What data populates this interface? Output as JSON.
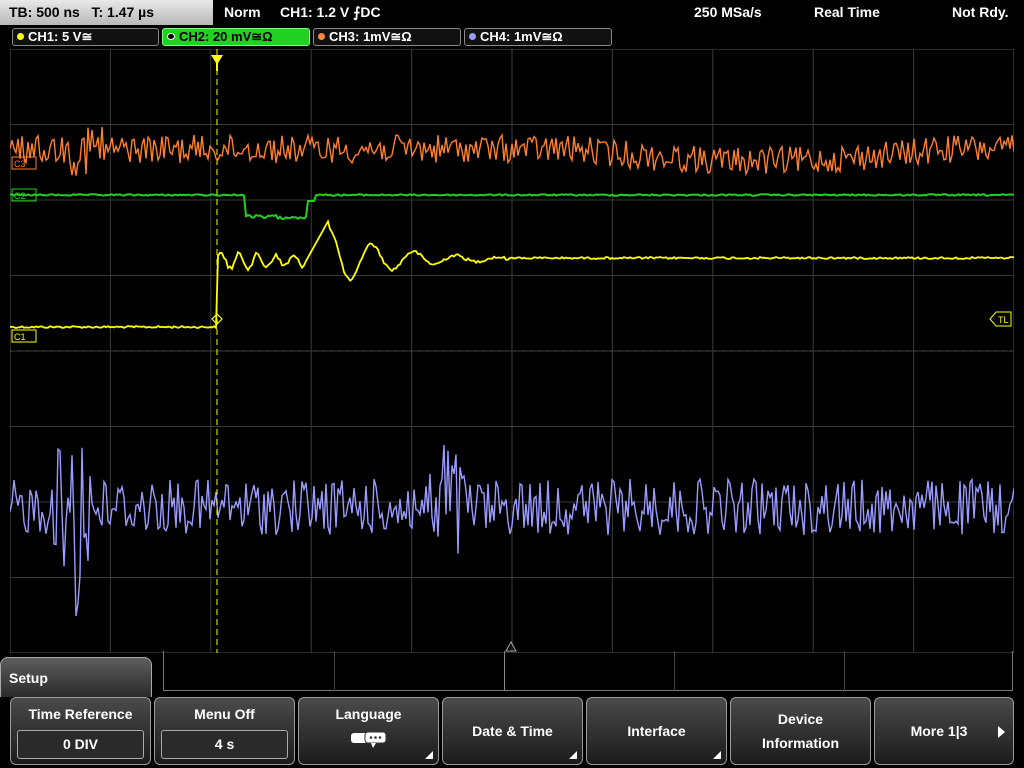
{
  "status": {
    "timebase": "TB: 500 ns",
    "time": "T: 1.47 µs",
    "mode": "Norm",
    "trigger": "CH1: 1.2 V ⨍DC",
    "samplerate": "250 MSa/s",
    "acq": "Real Time",
    "state": "Not Rdy."
  },
  "channels": [
    {
      "label": "CH1: 5 V≅",
      "color": "#ffff00"
    },
    {
      "label": "CH2: 20 mV≅Ω",
      "color": "#22d022"
    },
    {
      "label": "CH3: 1mV≅Ω",
      "color": "#ff8a3c"
    },
    {
      "label": "CH4: 1mV≅Ω",
      "color": "#9a9aff"
    }
  ],
  "markers": {
    "c1": "C1",
    "c2": "C2",
    "c3": "C3",
    "tl": "TL"
  },
  "menu": {
    "title": "Setup",
    "softkeys": [
      {
        "label": "Time Reference",
        "value": "0 DIV"
      },
      {
        "label": "Menu Off",
        "value": "4 s"
      },
      {
        "label": "Language"
      },
      {
        "label": "Date & Time"
      },
      {
        "label": "Interface"
      },
      {
        "label": "Device",
        "label2": "Information"
      },
      {
        "label": "More 1|3"
      }
    ]
  }
}
